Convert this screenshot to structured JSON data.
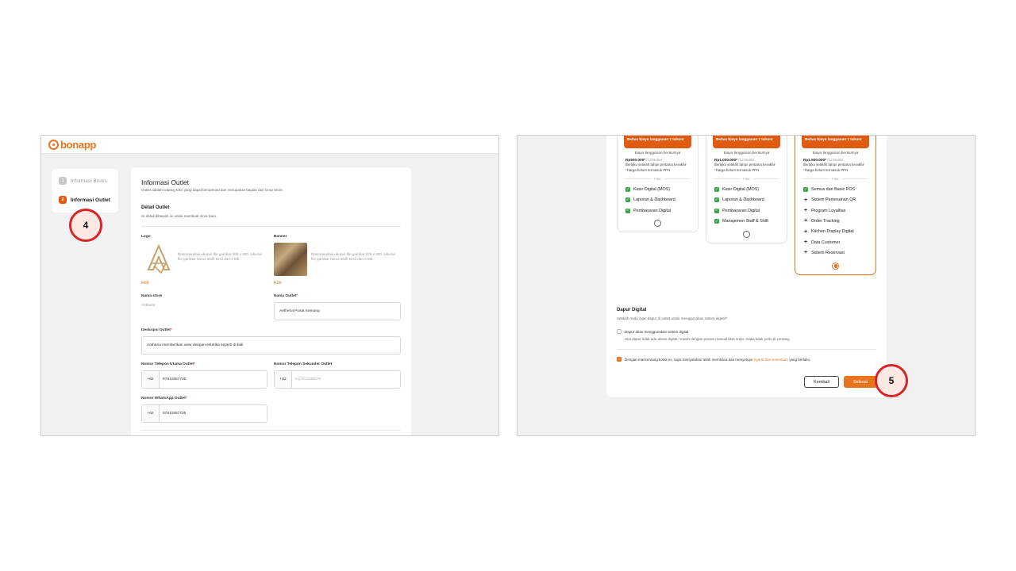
{
  "left": {
    "app_name": "bonapp",
    "steps": [
      {
        "num": "1",
        "label": "Informasi Bisnis"
      },
      {
        "num": "2",
        "label": "Informasi Outlet"
      }
    ],
    "callout": "4",
    "form": {
      "title": "Informasi Outlet",
      "subtitle": "Outlet adalah cabang toko yang dapat beroperasi dan merupakan bagian dari Grup Store.",
      "section_title": "Detail Outlet",
      "section_sub": "Isi detail dibawah ini untuk membuat store baru.",
      "logo_label": "Logo",
      "logo_hint": "Rekomendasi ukuran file gambar 300 x 300. Ukuran file gambar harus lebih kecil dari 2 Mb.",
      "logo_edit": "Edit",
      "banner_label": "Banner",
      "banner_hint": "Rekomendasi ukuran file gambar 375 x 300. Ukuran file gambar harus lebih kecil dari 2 Mb.",
      "banner_edit": "Edit",
      "store_name_label": "Nama store",
      "store_name_value": "Aetheria",
      "outlet_name_label": "Nama Outlet",
      "outlet_name_value": "Aetheria Pusat Kemang",
      "desc_label": "Deskripsi Outlet",
      "desc_value": "Aetheria memberikan view dengan estetika seperti di bali",
      "phone_main_label": "Nomor Telepon Utama Outlet",
      "phone_main_cc": "+62",
      "phone_main_value": "87812557735",
      "phone_second_label": "Nomor Telepon Sekunder Outlet",
      "phone_second_cc": "+62",
      "phone_second_placeholder": "e.g 812345678",
      "wa_label": "Nomor WhatsApp Outlet",
      "wa_cc": "+62",
      "wa_value": "87812557735",
      "required_mark": "*"
    }
  },
  "right": {
    "plans": [
      {
        "banner": "Bebas biaya langganan 1 tahun!",
        "billing_label": "Biaya langganan berikutnya",
        "price": "Rp500.000*",
        "period": "/12 Bulan",
        "note1": "Berlaku setelah tahun pertama berakhir",
        "note2": "*Harga belum termasuk PPN",
        "fitur": "Fitur",
        "features": [
          {
            "icon": "check",
            "label": "Kasir Digital (MOS)"
          },
          {
            "icon": "check",
            "label": "Laporan & Dashboard"
          },
          {
            "icon": "check",
            "label": "Pembayaran Digital"
          }
        ],
        "selected": false
      },
      {
        "banner": "Bebas biaya langganan 1 tahun!",
        "billing_label": "Biaya langganan berikutnya",
        "price": "Rp1.000.000*",
        "period": "/12 Bulan",
        "note1": "Berlaku setelah tahun pertama berakhir",
        "note2": "*Harga belum termasuk PPN",
        "fitur": "Fitur",
        "features": [
          {
            "icon": "check",
            "label": "Kasir Digital (MOS)"
          },
          {
            "icon": "check",
            "label": "Laporan & Dashboard"
          },
          {
            "icon": "check",
            "label": "Pembayaran Digital"
          },
          {
            "icon": "check",
            "label": "Manajemen Staff & Shift"
          }
        ],
        "selected": false
      },
      {
        "banner": "Bebas biaya langganan 1 tahun!",
        "billing_label": "Biaya langganan berikutnya",
        "price": "Rp1.500.000*",
        "period": "/12 Bulan",
        "note1": "Berlaku setelah tahun pertama berakhir",
        "note2": "*Harga belum termasuk PPN",
        "fitur": "Fitur",
        "features": [
          {
            "icon": "check",
            "label": "Semua dari Basic POS"
          },
          {
            "icon": "plus",
            "label": "Sistem Pemesanan QR"
          },
          {
            "icon": "plus",
            "label": "Program Loyalitas"
          },
          {
            "icon": "plus",
            "label": "Order Tracking"
          },
          {
            "icon": "plus",
            "label": "Kitchen Display Digital"
          },
          {
            "icon": "plus",
            "label": "Data Customer"
          },
          {
            "icon": "plus",
            "label": "Sistem Reservasi"
          }
        ],
        "selected": true
      }
    ],
    "dapur": {
      "title": "Dapur Digital",
      "question": "Apakah Anda ingin dapur di outlet untuk menggunakan sistem digital?",
      "checkbox_label": "Dapur akan menggunakan sistem digital",
      "checkbox_hint": "Jika dapur tidak ada akses digital / masih dengan proses manual tiket order, maka tidak perlu di centang"
    },
    "terms": {
      "prefix": "Dengan mencentang kotak ini, saya menyatakan telah membaca dan menyetujui",
      "link": "Syarat dan Ketentuan",
      "suffix": "yang berlaku."
    },
    "back_button": "Kembali",
    "done_button": "Selesai",
    "callout": "5"
  },
  "colors": {
    "accent": "#e8741e",
    "banner": "#e05a10",
    "callout_ring": "#d6262b",
    "check": "#3ea44a"
  }
}
